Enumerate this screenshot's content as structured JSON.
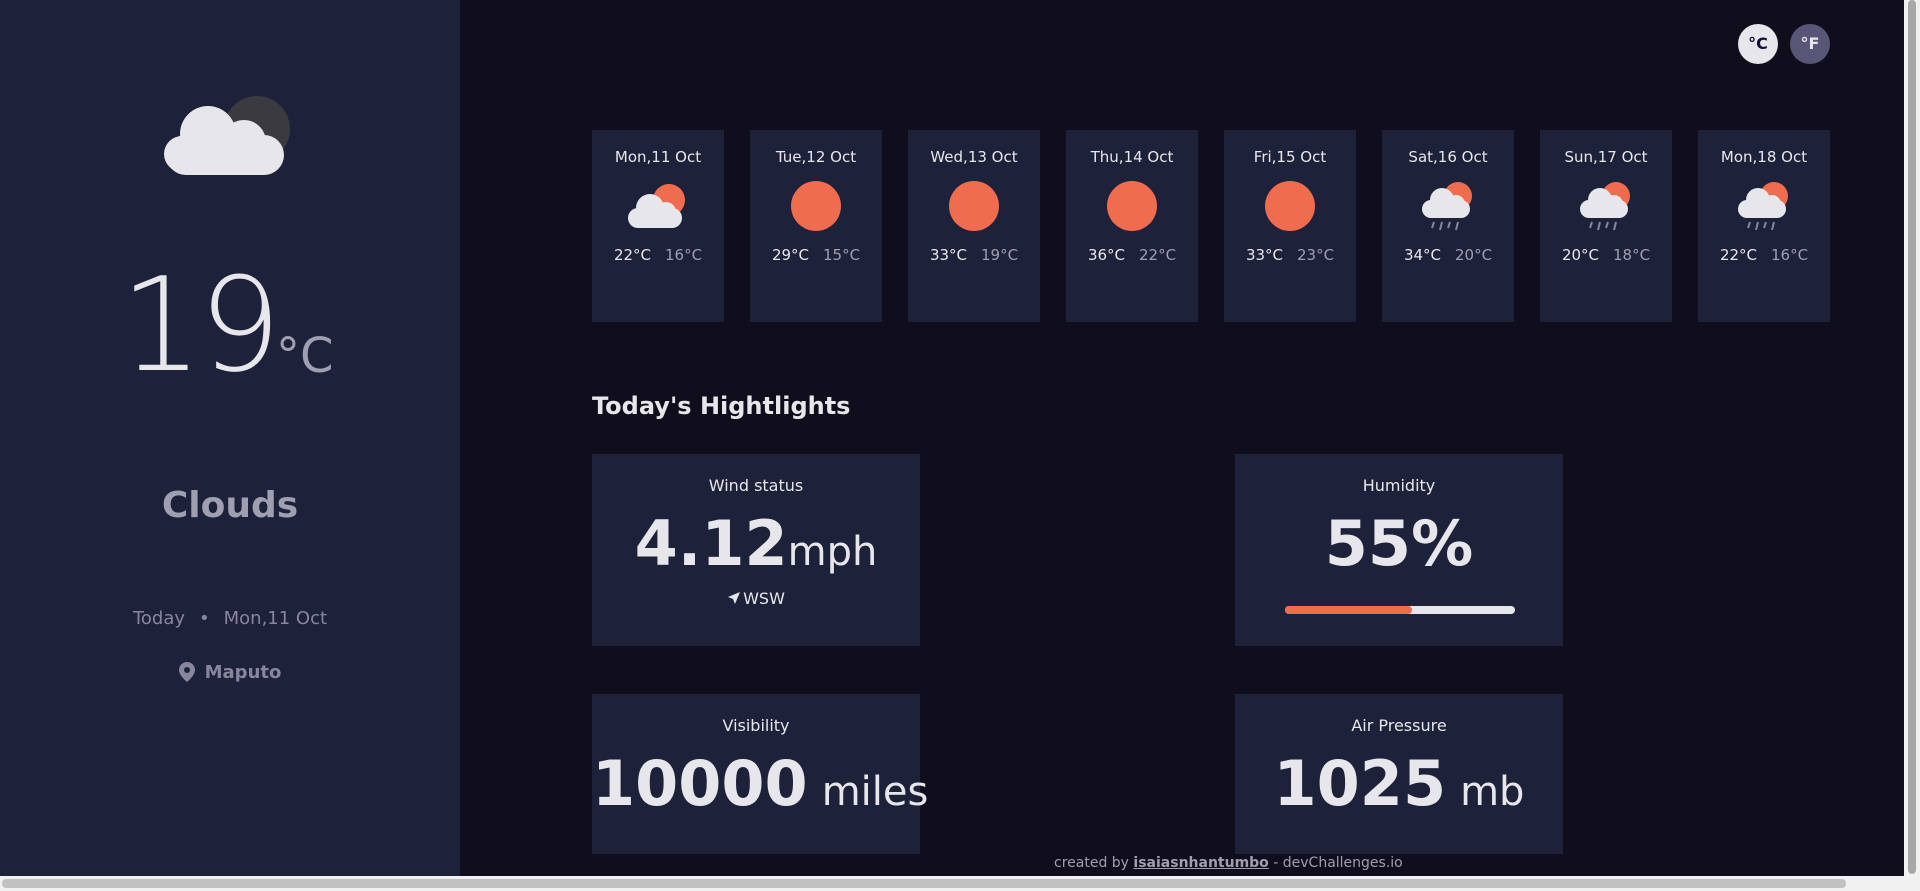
{
  "current": {
    "temperature": "19",
    "unit": "°C",
    "condition": "Clouds",
    "today_label": "Today",
    "separator": "•",
    "date": "Mon,11 Oct",
    "location": "Maputo",
    "icon": "clouds-icon"
  },
  "units": {
    "celsius": "°C",
    "fahrenheit": "°F"
  },
  "forecast": [
    {
      "day": "Mon,11 Oct",
      "max": "22°C",
      "min": "16°C",
      "icon": "cloud-sun-icon"
    },
    {
      "day": "Tue,12 Oct",
      "max": "29°C",
      "min": "15°C",
      "icon": "sun-icon"
    },
    {
      "day": "Wed,13 Oct",
      "max": "33°C",
      "min": "19°C",
      "icon": "sun-icon"
    },
    {
      "day": "Thu,14 Oct",
      "max": "36°C",
      "min": "22°C",
      "icon": "sun-icon"
    },
    {
      "day": "Fri,15 Oct",
      "max": "33°C",
      "min": "23°C",
      "icon": "sun-icon"
    },
    {
      "day": "Sat,16 Oct",
      "max": "34°C",
      "min": "20°C",
      "icon": "rain-sun-icon"
    },
    {
      "day": "Sun,17 Oct",
      "max": "20°C",
      "min": "18°C",
      "icon": "rain-sun-icon"
    },
    {
      "day": "Mon,18 Oct",
      "max": "22°C",
      "min": "16°C",
      "icon": "rain-sun-icon"
    }
  ],
  "highlights": {
    "title": "Today's Hightlights",
    "wind": {
      "label": "Wind status",
      "value": "4.12",
      "unit": "mph",
      "direction": "WSW"
    },
    "humidity": {
      "label": "Humidity",
      "value": "55",
      "unit": "%",
      "percent": 55
    },
    "visibility": {
      "label": "Visibility",
      "value": "10000",
      "unit": "miles"
    },
    "pressure": {
      "label": "Air Pressure",
      "value": "1025",
      "unit": "mb"
    }
  },
  "footer": {
    "prefix": "created by",
    "author": "isaiasnhantumbo",
    "suffix": "- devChallenges.io"
  },
  "colors": {
    "sidebar": "#1e213a",
    "background": "#100e1d",
    "accent": "#ef6c4f",
    "text": "#e7e7eb",
    "muted": "#a09fb1"
  }
}
